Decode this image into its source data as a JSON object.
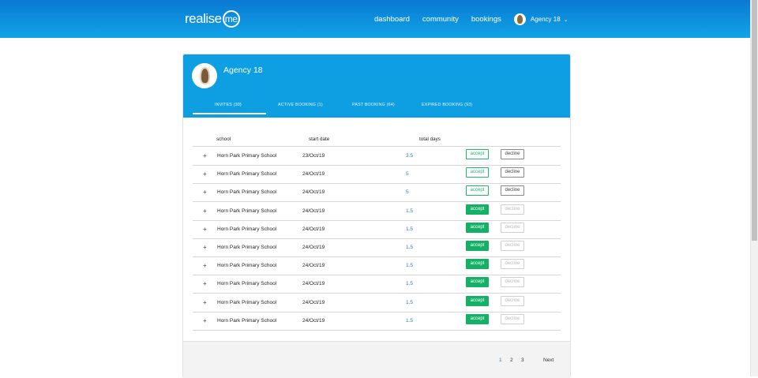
{
  "header": {
    "logo_text": "realise",
    "logo_badge": "me",
    "nav": [
      {
        "label": "dashboard"
      },
      {
        "label": "community"
      },
      {
        "label": "bookings"
      }
    ],
    "user_name": "Agency 18",
    "user_chevron": "⌄"
  },
  "profile": {
    "name": "Agency 18",
    "tabs": [
      {
        "label": "INVITES (30)",
        "active": true
      },
      {
        "label": "ACTIVE BOOKING (1)",
        "active": false
      },
      {
        "label": "PAST BOOKING (64)",
        "active": false
      },
      {
        "label": "EXPIRED BOOKING (93)",
        "active": false
      }
    ]
  },
  "table": {
    "columns": [
      "school",
      "start date",
      "total days"
    ],
    "rows": [
      {
        "expand": "+",
        "school": "Horn Park Primary School",
        "start_date": "23/Oct/19",
        "total_days": "3.5",
        "accept": "accept",
        "decline": "decline",
        "style": "outline"
      },
      {
        "expand": "+",
        "school": "Horn Park Primary School",
        "start_date": "24/Oct/19",
        "total_days": "5",
        "accept": "accept",
        "decline": "decline",
        "style": "outline"
      },
      {
        "expand": "+",
        "school": "Horn Park Primary School",
        "start_date": "24/Oct/19",
        "total_days": "5",
        "accept": "accept",
        "decline": "decline",
        "style": "outline"
      },
      {
        "expand": "+",
        "school": "Horn Park Primary School",
        "start_date": "24/Oct/19",
        "total_days": "1.5",
        "accept": "accept",
        "decline": "decline",
        "style": "solid"
      },
      {
        "expand": "+",
        "school": "Horn Park Primary School",
        "start_date": "24/Oct/19",
        "total_days": "1.5",
        "accept": "accept",
        "decline": "decline",
        "style": "solid"
      },
      {
        "expand": "+",
        "school": "Horn Park Primary School",
        "start_date": "24/Oct/19",
        "total_days": "1.5",
        "accept": "accept",
        "decline": "decline",
        "style": "solid"
      },
      {
        "expand": "+",
        "school": "Horn Park Primary School",
        "start_date": "24/Oct/19",
        "total_days": "1.5",
        "accept": "accept",
        "decline": "decline",
        "style": "solid"
      },
      {
        "expand": "+",
        "school": "Horn Park Primary School",
        "start_date": "24/Oct/19",
        "total_days": "1.5",
        "accept": "accept",
        "decline": "decline",
        "style": "solid"
      },
      {
        "expand": "+",
        "school": "Horn Park Primary School",
        "start_date": "24/Oct/19",
        "total_days": "1.5",
        "accept": "accept",
        "decline": "decline",
        "style": "solid"
      },
      {
        "expand": "+",
        "school": "Horn Park Primary School",
        "start_date": "24/Oct/19",
        "total_days": "1.5",
        "accept": "accept",
        "decline": "decline",
        "style": "solid"
      }
    ]
  },
  "pagination": {
    "pages": [
      {
        "label": "1",
        "current": true
      },
      {
        "label": "2",
        "current": false
      },
      {
        "label": "3",
        "current": false
      }
    ],
    "next_label": "Next"
  },
  "colors": {
    "header_blue": "#0e9ee2",
    "accept_green": "#13b066",
    "days_blue": "#3476c8"
  }
}
